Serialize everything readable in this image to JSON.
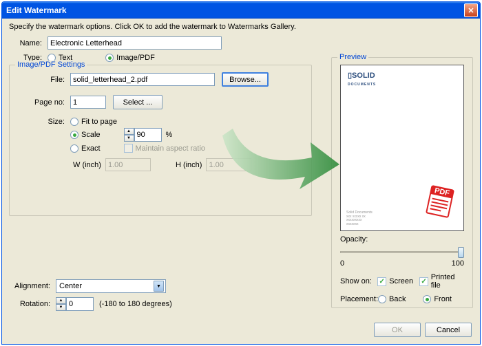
{
  "title": "Edit Watermark",
  "description": "Specify the watermark options. Click OK to add the watermark to Watermarks Gallery.",
  "name_label": "Name:",
  "name_value": "Electronic Letterhead",
  "type_label": "Type:",
  "type_text": "Text",
  "type_image": "Image/PDF",
  "settings_legend": "Image/PDF Settings",
  "file_label": "File:",
  "file_value": "solid_letterhead_2.pdf",
  "browse_label": "Browse...",
  "pageno_label": "Page no:",
  "pageno_value": "1",
  "select_label": "Select ...",
  "size_label": "Size:",
  "size_fit": "Fit to page",
  "size_scale": "Scale",
  "scale_value": "90",
  "percent": "%",
  "size_exact": "Exact",
  "aspect_label": "Maintain aspect ratio",
  "w_label": "W (inch)",
  "w_value": "1.00",
  "h_label": "H (inch)",
  "h_value": "1.00",
  "alignment_label": "Alignment:",
  "alignment_value": "Center",
  "rotation_label": "Rotation:",
  "rotation_value": "0",
  "rotation_hint": "(-180 to 180 degrees)",
  "preview_legend": "Preview",
  "preview_logo": "▯SOLID",
  "preview_logo2": "DOCUMENTS",
  "opacity_label": "Opacity:",
  "opacity_min": "0",
  "opacity_max": "100",
  "showon_label": "Show on:",
  "showon_screen": "Screen",
  "showon_printed": "Printed file",
  "placement_label": "Placement:",
  "placement_back": "Back",
  "placement_front": "Front",
  "ok_label": "OK",
  "cancel_label": "Cancel"
}
